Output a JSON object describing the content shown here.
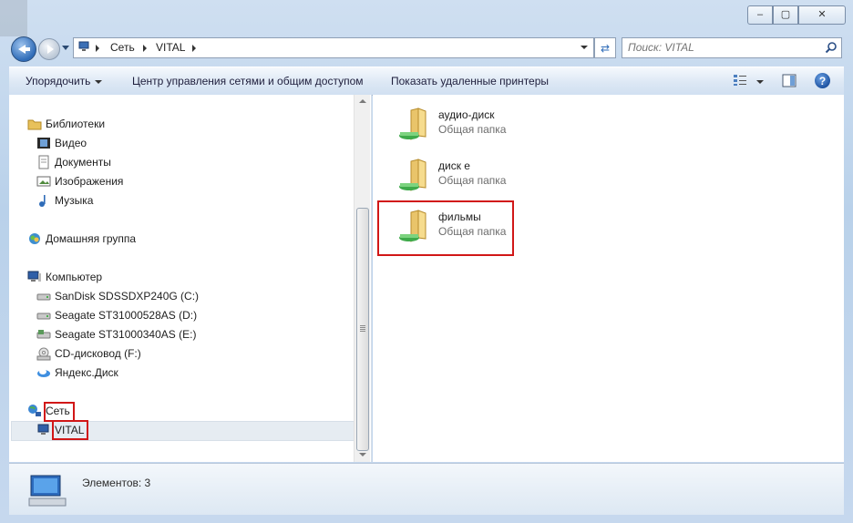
{
  "window": {
    "caption_minimize": "–",
    "caption_maximize": "▢",
    "caption_close": "✕"
  },
  "address": {
    "crumbs": [
      "Сеть",
      "VITAL"
    ]
  },
  "search": {
    "placeholder": "Поиск: VITAL"
  },
  "toolbar": {
    "organize": "Упорядочить",
    "network_center": "Центр управления сетями и общим доступом",
    "show_printers": "Показать удаленные принтеры",
    "help": "?"
  },
  "nav": {
    "libraries": {
      "label": "Библиотеки",
      "icon": "libraries-icon"
    },
    "library_items": [
      {
        "label": "Видео",
        "icon": "video-library-icon"
      },
      {
        "label": "Документы",
        "icon": "documents-library-icon"
      },
      {
        "label": "Изображения",
        "icon": "pictures-library-icon"
      },
      {
        "label": "Музыка",
        "icon": "music-library-icon"
      }
    ],
    "homegroup": {
      "label": "Домашняя группа",
      "icon": "homegroup-icon"
    },
    "computer": {
      "label": "Компьютер",
      "icon": "computer-icon"
    },
    "drives": [
      {
        "label": "SanDisk SDSSDXP240G (C:)",
        "icon": "hard-drive-icon"
      },
      {
        "label": "Seagate ST31000528AS (D:)",
        "icon": "hard-drive-icon"
      },
      {
        "label": "Seagate ST31000340AS (E:)",
        "icon": "hard-drive-icon"
      },
      {
        "label": "CD-дисковод (F:)",
        "icon": "cd-drive-icon"
      },
      {
        "label": "Яндекс.Диск",
        "icon": "yandex-disk-icon"
      }
    ],
    "network": {
      "label": "Сеть",
      "icon": "network-icon"
    },
    "network_host": {
      "label": "VITAL",
      "icon": "network-computer-icon"
    }
  },
  "content": {
    "items": [
      {
        "name": "аудио-диск",
        "type": "Общая папка"
      },
      {
        "name": "диск е",
        "type": "Общая папка"
      },
      {
        "name": "фильмы",
        "type": "Общая папка"
      }
    ]
  },
  "details": {
    "count_text": "Элементов: 3"
  },
  "colors": {
    "highlight": "#d11717",
    "accent": "#2f6cb8"
  }
}
